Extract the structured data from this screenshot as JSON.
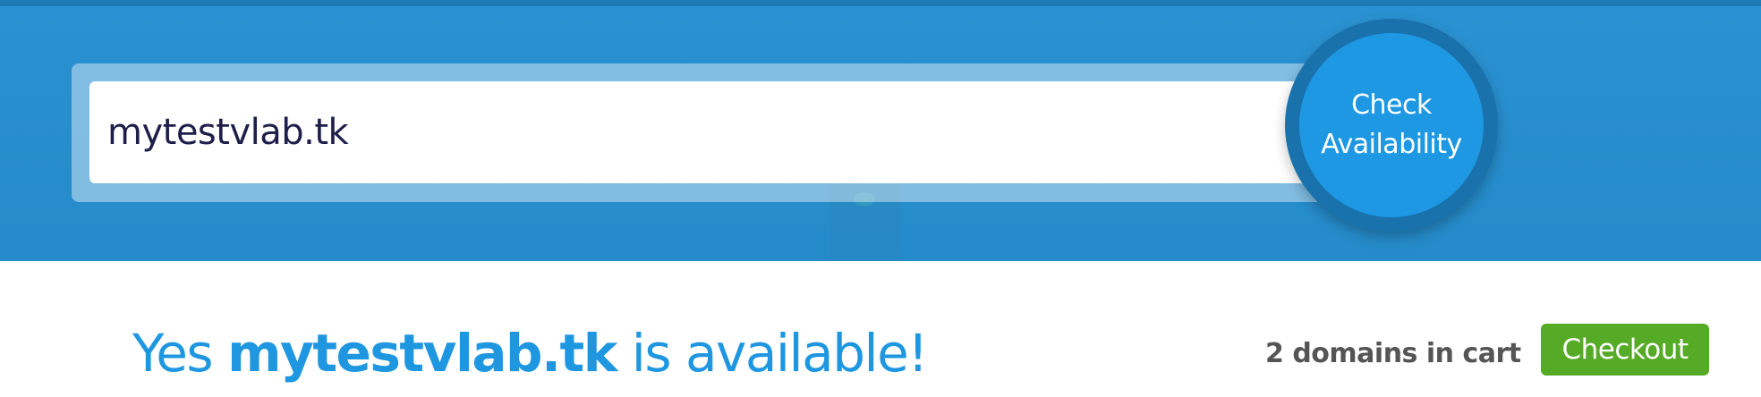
{
  "search": {
    "value": "mytestvlab.tk",
    "button_line1": "Check",
    "button_line2": "Availability"
  },
  "result": {
    "prefix": "Yes ",
    "domain": "mytestvlab.tk",
    "suffix": " is available!"
  },
  "cart": {
    "count_text": "2 domains in cart",
    "checkout_label": "Checkout"
  },
  "colors": {
    "hero_blue": "#2690d1",
    "button_blue": "#1e98e3",
    "result_blue": "#1f97e0",
    "checkout_green": "#55ab26"
  }
}
